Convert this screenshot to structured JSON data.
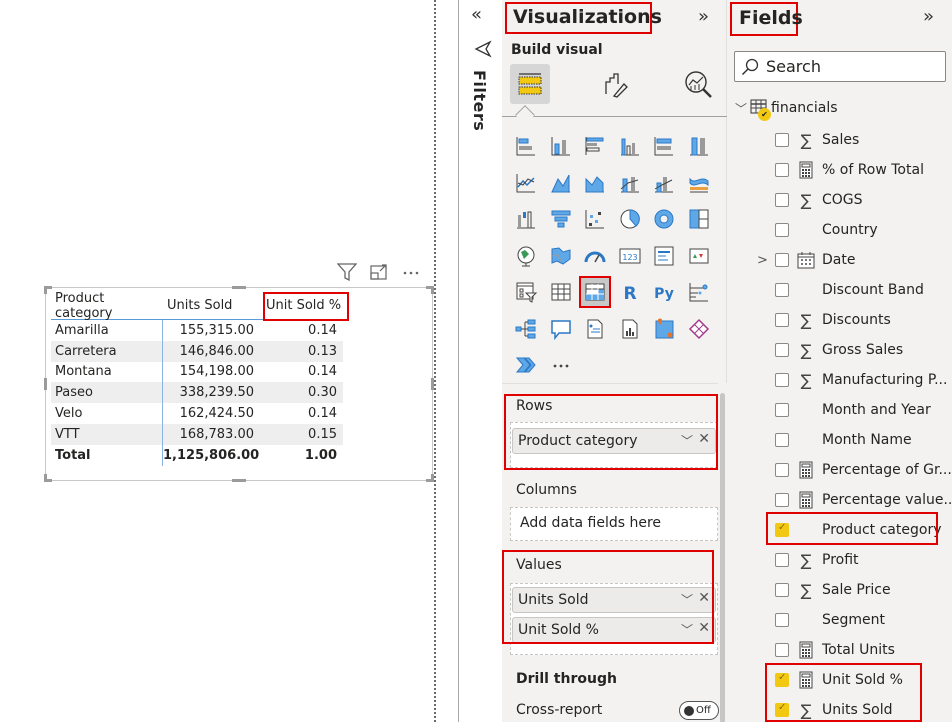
{
  "visual": {
    "header_icons": [
      "filter-icon",
      "focus-mode-icon",
      "more-options-icon"
    ],
    "table": {
      "columns": [
        "Product category",
        "Units Sold",
        "Unit Sold %"
      ],
      "rows": [
        {
          "category": "Amarilla",
          "units_sold": "155,315.00",
          "unit_sold_pct": "0.14"
        },
        {
          "category": "Carretera",
          "units_sold": "146,846.00",
          "unit_sold_pct": "0.13"
        },
        {
          "category": "Montana",
          "units_sold": "154,198.00",
          "unit_sold_pct": "0.14"
        },
        {
          "category": "Paseo",
          "units_sold": "338,239.50",
          "unit_sold_pct": "0.30"
        },
        {
          "category": "Velo",
          "units_sold": "162,424.50",
          "unit_sold_pct": "0.14"
        },
        {
          "category": "VTT",
          "units_sold": "168,783.00",
          "unit_sold_pct": "0.15"
        }
      ],
      "total": {
        "category": "Total",
        "units_sold": "1,125,806.00",
        "unit_sold_pct": "1.00"
      }
    }
  },
  "filters": {
    "label": "Filters",
    "collapse_glyph": "«"
  },
  "visualizations": {
    "title": "Visualizations",
    "expand_glyph": "»",
    "build_label": "Build visual",
    "build_tabs": [
      "build-visual",
      "format-visual",
      "analytics"
    ],
    "visual_types": [
      "stacked-bar-chart",
      "stacked-column-chart",
      "clustered-bar-chart",
      "clustered-column-chart",
      "100pct-stacked-bar-chart",
      "100pct-stacked-column-chart",
      "line-chart",
      "area-chart",
      "stacked-area-chart",
      "line-and-stacked-column-chart",
      "line-and-clustered-column-chart",
      "ribbon-chart",
      "waterfall-chart",
      "funnel-chart",
      "scatter-chart",
      "pie-chart",
      "donut-chart",
      "treemap",
      "map",
      "filled-map",
      "gauge",
      "card",
      "multi-row-card",
      "kpi",
      "slicer",
      "table",
      "matrix",
      "r-script-visual",
      "python-visual",
      "key-influencers",
      "decomposition-tree",
      "q-and-a",
      "smart-narrative",
      "paginated-report",
      "azure-map",
      "power-apps",
      "power-automate",
      "more-visuals"
    ],
    "selected_visual": "matrix",
    "wells": {
      "rows": {
        "label": "Rows",
        "fields": [
          "Product category"
        ]
      },
      "columns": {
        "label": "Columns",
        "placeholder": "Add data fields here"
      },
      "values": {
        "label": "Values",
        "fields": [
          "Units Sold",
          "Unit Sold %"
        ]
      }
    },
    "drill_through": {
      "label": "Drill through",
      "cross_report_label": "Cross-report",
      "cross_report_state": "Off"
    }
  },
  "fields": {
    "title": "Fields",
    "expand_glyph": "»",
    "search_placeholder": "Search",
    "table_name": "financials",
    "items": [
      {
        "name": "Sales",
        "icon": "sigma",
        "checked": false
      },
      {
        "name": "% of Row Total",
        "icon": "calculator",
        "checked": false
      },
      {
        "name": "COGS",
        "icon": "sigma",
        "checked": false
      },
      {
        "name": "Country",
        "icon": "none",
        "checked": false
      },
      {
        "name": "Date",
        "icon": "calendar",
        "checked": false,
        "expandable": true
      },
      {
        "name": "Discount Band",
        "icon": "none",
        "checked": false
      },
      {
        "name": "Discounts",
        "icon": "sigma",
        "checked": false
      },
      {
        "name": "Gross Sales",
        "icon": "sigma",
        "checked": false
      },
      {
        "name": "Manufacturing P...",
        "icon": "sigma",
        "checked": false
      },
      {
        "name": "Month and Year",
        "icon": "none",
        "checked": false
      },
      {
        "name": "Month Name",
        "icon": "none",
        "checked": false
      },
      {
        "name": "Percentage of Gr...",
        "icon": "calculator",
        "checked": false
      },
      {
        "name": "Percentage value...",
        "icon": "calculator",
        "checked": false
      },
      {
        "name": "Product category",
        "icon": "none",
        "checked": true
      },
      {
        "name": "Profit",
        "icon": "sigma",
        "checked": false
      },
      {
        "name": "Sale Price",
        "icon": "sigma",
        "checked": false
      },
      {
        "name": "Segment",
        "icon": "none",
        "checked": false
      },
      {
        "name": "Total Units",
        "icon": "calculator",
        "checked": false
      },
      {
        "name": "Unit Sold %",
        "icon": "calculator",
        "checked": true
      },
      {
        "name": "Units Sold",
        "icon": "sigma",
        "checked": true
      }
    ]
  },
  "colors": {
    "highlight_red": "#e00000",
    "accent_yellow": "#f2c811",
    "pane_bg": "#f3f2f1",
    "table_divider_blue": "#5b9bd5"
  }
}
